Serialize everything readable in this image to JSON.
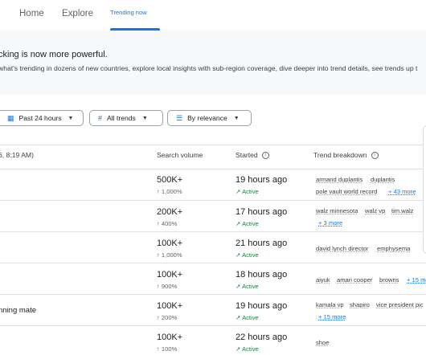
{
  "nav": {
    "home": "Home",
    "explore": "Explore",
    "trending": "Trending now"
  },
  "banner": {
    "title": "cking is now more powerful.",
    "text": "what's trending in dozens of new countries, explore local insights with sub-region coverage, dive deeper into trend details, see trends up t"
  },
  "filters": {
    "time": "Past 24 hours",
    "trends": "All trends",
    "sort": "By relevance"
  },
  "table": {
    "date_header": "6, 8:19 AM)",
    "headers": {
      "volume": "Search volume",
      "started": "Started",
      "breakdown": "Trend breakdown"
    },
    "rows": [
      {
        "name": "",
        "volume": "500K+",
        "pct": "↑ 1,000%",
        "started": "19 hours ago",
        "status": "Active",
        "words": [
          "armand duplantis",
          "duplantis",
          "pole vault world record"
        ],
        "more": "+ 43 more"
      },
      {
        "name": "",
        "volume": "200K+",
        "pct": "↑ 400%",
        "started": "17 hours ago",
        "status": "Active",
        "words": [
          "walz minnesota",
          "walz vp",
          "tim.walz"
        ],
        "more": "+ 3 more"
      },
      {
        "name": "",
        "volume": "100K+",
        "pct": "↑ 1,000%",
        "started": "21 hours ago",
        "status": "Active",
        "words": [
          "david lynch director",
          "emphysema"
        ],
        "more": ""
      },
      {
        "name": "",
        "volume": "100K+",
        "pct": "↑ 900%",
        "started": "18 hours ago",
        "status": "Active",
        "words": [
          "aiyuk",
          "amari cooper",
          "browns"
        ],
        "more": "+ 15 mo"
      },
      {
        "name": "nning mate",
        "volume": "100K+",
        "pct": "↑ 200%",
        "started": "19 hours ago",
        "status": "Active",
        "words": [
          "kamala vp",
          "shapiro",
          "vice president pic"
        ],
        "more": "+ 15 more"
      },
      {
        "name": "",
        "volume": "100K+",
        "pct": "↑ 100%",
        "started": "22 hours ago",
        "status": "Active",
        "words": [
          "shoe"
        ],
        "more": ""
      }
    ]
  }
}
